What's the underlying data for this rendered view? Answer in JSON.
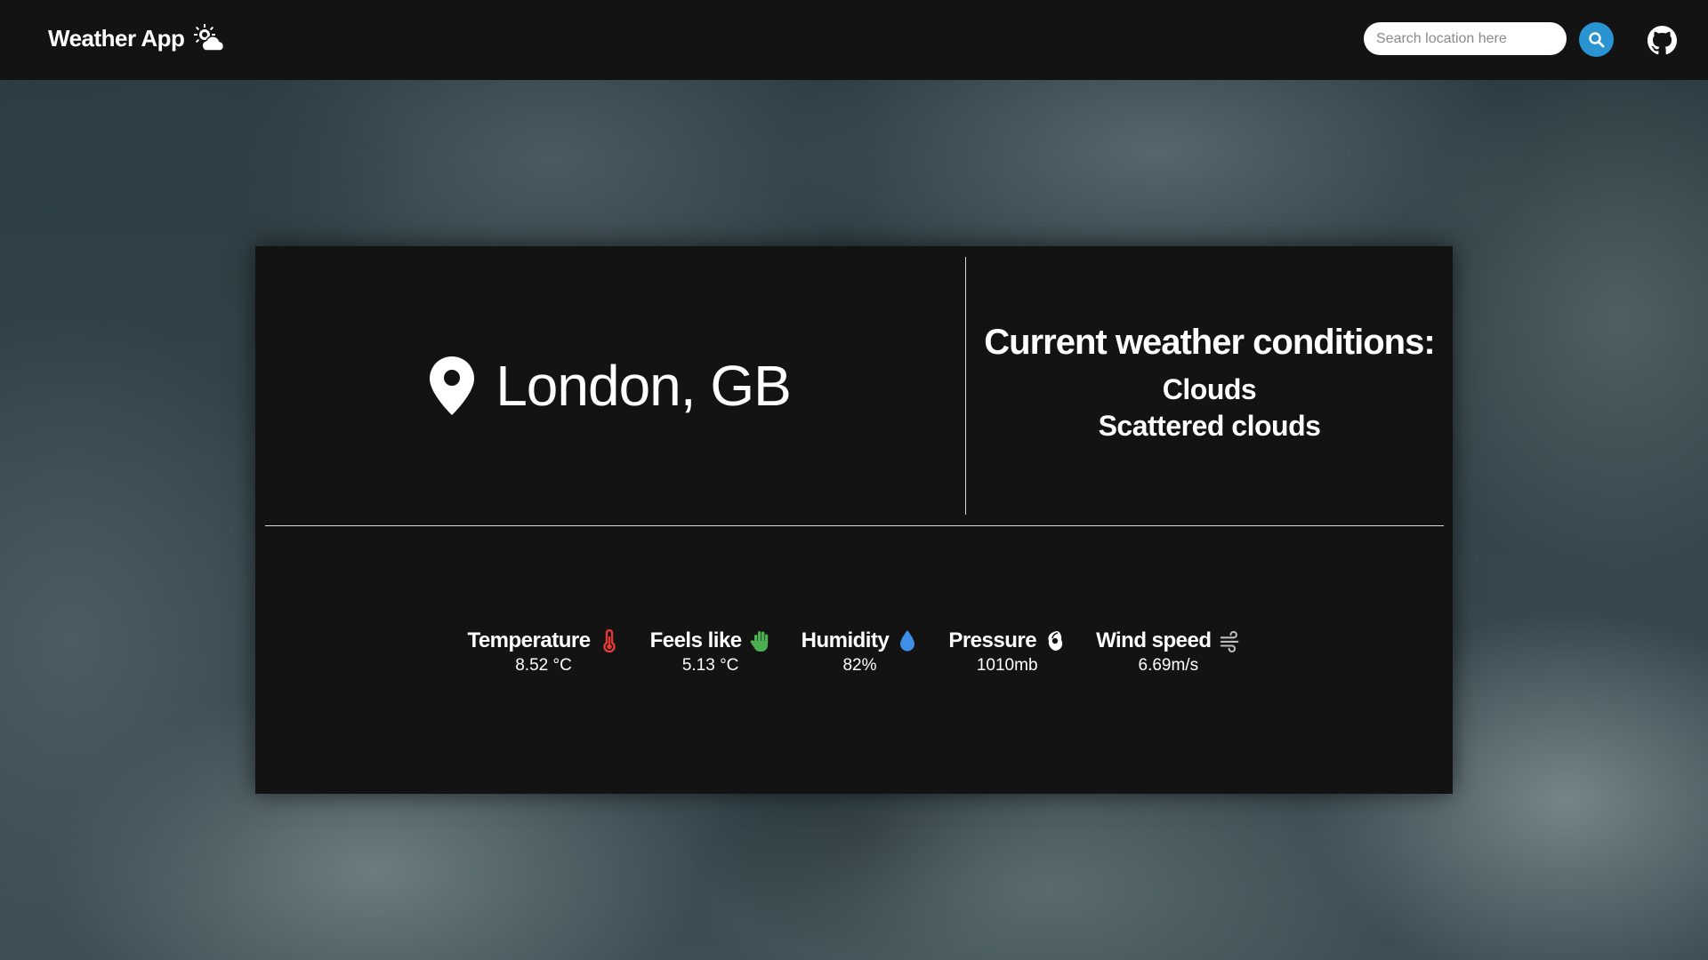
{
  "header": {
    "app_title": "Weather App",
    "app_icon": "sun-behind-cloud-icon",
    "search": {
      "placeholder": "Search location here",
      "value": "",
      "button_icon": "search-icon",
      "button_color": "#2a93d1"
    },
    "github_icon": "github-icon"
  },
  "location": {
    "icon": "map-pin-icon",
    "name": "London, GB"
  },
  "conditions": {
    "heading": "Current weather conditions:",
    "main": "Clouds",
    "description": "Scattered clouds"
  },
  "stats": {
    "temperature": {
      "label": "Temperature",
      "value": "8.52 °C",
      "icon": "thermometer-icon",
      "icon_color": "#e53935"
    },
    "feels_like": {
      "label": "Feels like",
      "value": "5.13 °C",
      "icon": "hand-icon",
      "icon_color": "#4caf50"
    },
    "humidity": {
      "label": "Humidity",
      "value": "82%",
      "icon": "water-drop-icon",
      "icon_color": "#3f8ee8"
    },
    "pressure": {
      "label": "Pressure",
      "value": "1010mb",
      "icon": "cyclone-icon",
      "icon_color": "#ffffff"
    },
    "wind_speed": {
      "label": "Wind speed",
      "value": "6.69m/s",
      "icon": "wind-icon",
      "icon_color": "#bdbdbd"
    }
  },
  "colors": {
    "bar_background": "#131313",
    "card_background": "#131313",
    "text": "#ffffff"
  }
}
